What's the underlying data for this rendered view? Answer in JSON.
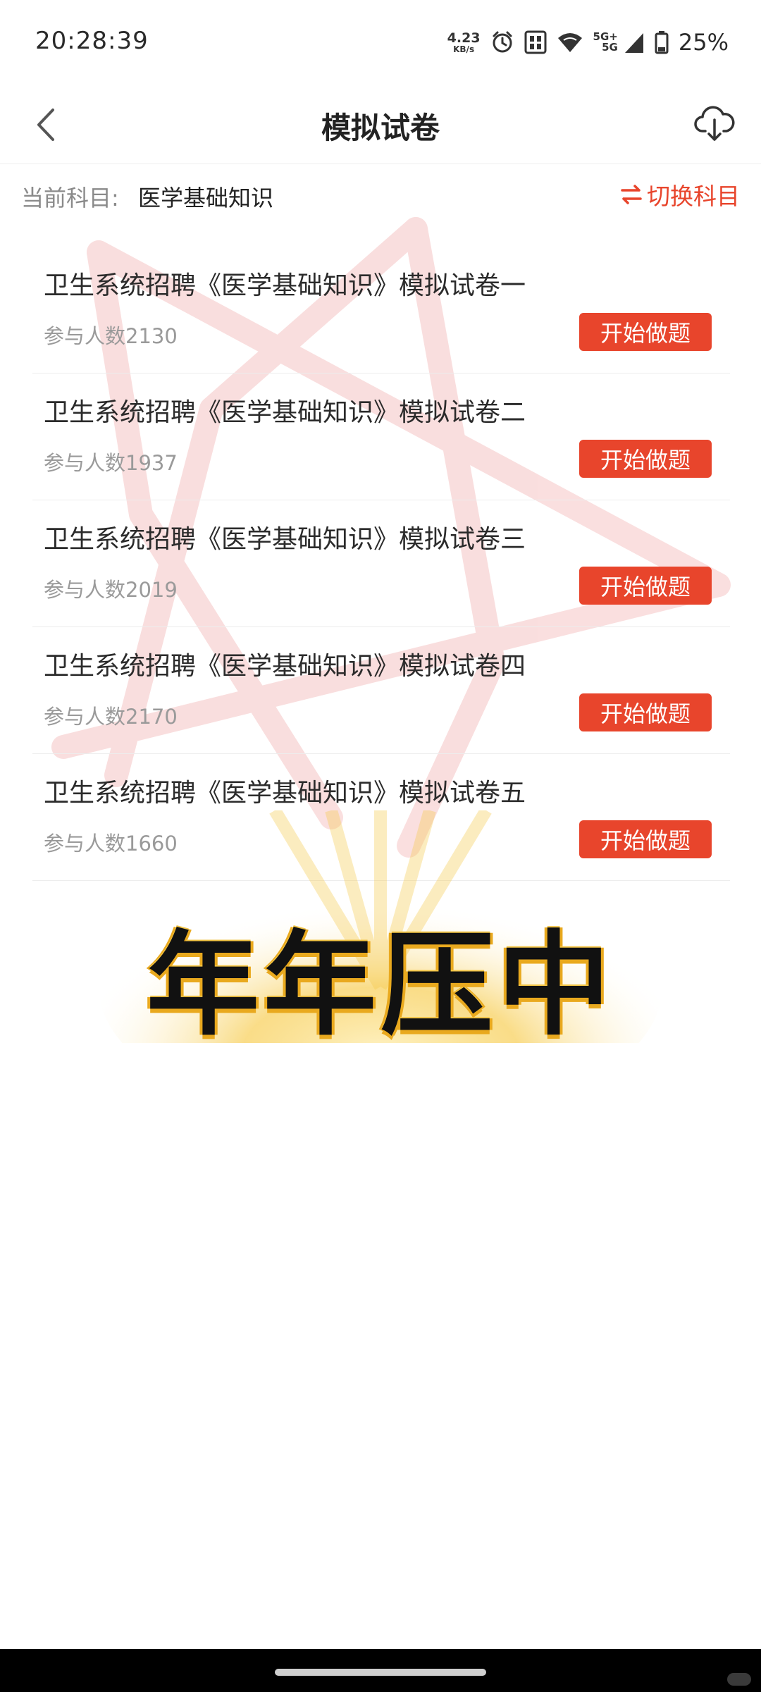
{
  "status_bar": {
    "time": "20:28:39",
    "net_speed_value": "4.23",
    "net_speed_unit": "KB/s",
    "network_top": "5G+",
    "network_bottom": "5G",
    "battery_percent": "25%",
    "icons": [
      "alarm-icon",
      "nfc-sim-icon",
      "wifi-icon",
      "signal-icon",
      "battery-icon"
    ]
  },
  "header": {
    "title": "模拟试卷",
    "back_icon": "chevron-left-icon",
    "download_icon": "cloud-download-icon"
  },
  "subject": {
    "label": "当前科目:",
    "value": "医学基础知识",
    "switch_label": "切换科目",
    "switch_icon": "swap-arrows-icon"
  },
  "papers": [
    {
      "title": "卫生系统招聘《医学基础知识》模拟试卷一",
      "participants": "参与人数2130",
      "button": "开始做题"
    },
    {
      "title": "卫生系统招聘《医学基础知识》模拟试卷二",
      "participants": "参与人数1937",
      "button": "开始做题"
    },
    {
      "title": "卫生系统招聘《医学基础知识》模拟试卷三",
      "participants": "参与人数2019",
      "button": "开始做题"
    },
    {
      "title": "卫生系统招聘《医学基础知识》模拟试卷四",
      "participants": "参与人数2170",
      "button": "开始做题"
    },
    {
      "title": "卫生系统招聘《医学基础知识》模拟试卷五",
      "participants": "参与人数1660",
      "button": "开始做题"
    }
  ],
  "promo": {
    "text": "年年压中"
  },
  "colors": {
    "accent": "#e8452c",
    "watermark": "#f9d9d9",
    "promo_glow": "#f6c94a"
  }
}
